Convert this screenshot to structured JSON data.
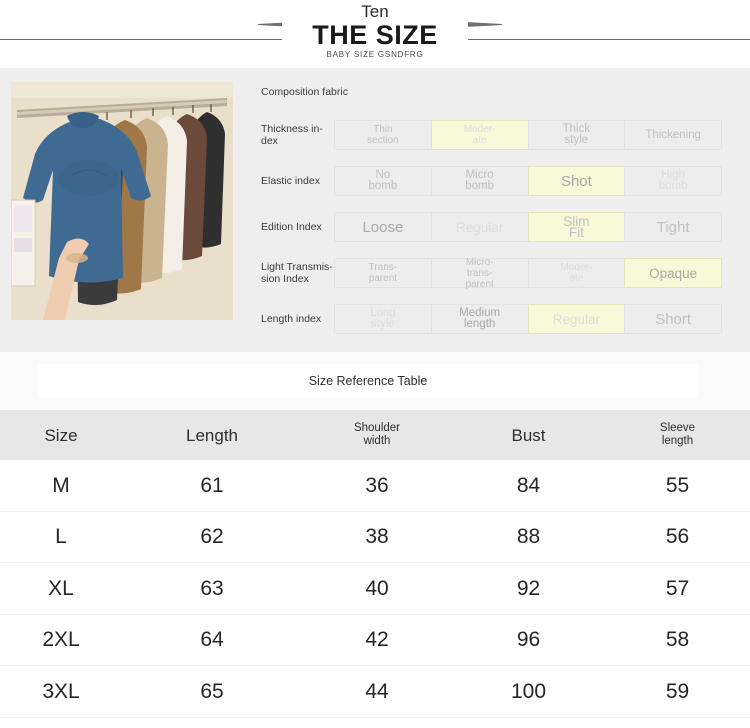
{
  "header": {
    "ghost_glyph": "··",
    "brand": "Ten",
    "title": "THE SIZE",
    "subtitle": "BABY SIZE GSNDFRG"
  },
  "product_photo": {
    "alt_name": "sweaters-on-rack-photo",
    "colors": [
      "#3f6a92",
      "#3b3b3b",
      "#a07848",
      "#c9b48f",
      "#f3efe6",
      "#6b4a3c",
      "#2f2f2f"
    ],
    "background": "#e9dfcb"
  },
  "attributes": {
    "section_label": "Composition fabric",
    "rows": [
      {
        "label": "Thickness in-dex",
        "options": [
          {
            "text": "Thin section",
            "selected": false,
            "size": "s1",
            "tone": "mid"
          },
          {
            "text": "Moder-ate",
            "selected": true,
            "size": "s1",
            "tone": "dim"
          },
          {
            "text": "Thick style",
            "selected": false,
            "size": "s2",
            "tone": "mid"
          },
          {
            "text": "Thickening",
            "selected": false,
            "size": "s2",
            "tone": "mid"
          }
        ]
      },
      {
        "label": "Elastic index",
        "options": [
          {
            "text": "No bomb",
            "selected": false,
            "size": "s2",
            "tone": "mid"
          },
          {
            "text": "Micro bomb",
            "selected": false,
            "size": "s2",
            "tone": "mid"
          },
          {
            "text": "Shot",
            "selected": true,
            "size": "s4",
            "tone": "dark"
          },
          {
            "text": "High bomb",
            "selected": false,
            "size": "s2",
            "tone": "dim"
          }
        ]
      },
      {
        "label": "Edition Index",
        "options": [
          {
            "text": "Loose",
            "selected": false,
            "size": "s4",
            "tone": "dark"
          },
          {
            "text": "Regular",
            "selected": false,
            "size": "s3",
            "tone": "dim"
          },
          {
            "text": "Slim Fit",
            "selected": true,
            "size": "s3",
            "tone": "mid"
          },
          {
            "text": "Tight",
            "selected": false,
            "size": "s4",
            "tone": "mid"
          }
        ]
      },
      {
        "label": "Light Transmis-sion Index",
        "options": [
          {
            "text": "Trans-parent",
            "selected": false,
            "size": "s1",
            "tone": "mid"
          },
          {
            "text": "Micro-trans-parent",
            "selected": false,
            "size": "s1",
            "tone": "mid"
          },
          {
            "text": "Moder-ate",
            "selected": false,
            "size": "s1",
            "tone": "dim"
          },
          {
            "text": "Opaque",
            "selected": true,
            "size": "s3",
            "tone": "dark"
          }
        ]
      },
      {
        "label": "Length index",
        "options": [
          {
            "text": "Long style",
            "selected": false,
            "size": "s2",
            "tone": "dim"
          },
          {
            "text": "Medium length",
            "selected": false,
            "size": "s2",
            "tone": "dark"
          },
          {
            "text": "Regular",
            "selected": true,
            "size": "s3",
            "tone": "dim"
          },
          {
            "text": "Short",
            "selected": false,
            "size": "s4",
            "tone": "mid"
          }
        ]
      }
    ]
  },
  "size_reference": {
    "banner": "Size Reference Table",
    "columns": [
      "Size",
      "Length",
      "Shoulder width",
      "Bust",
      "Sleeve length"
    ],
    "rows": [
      {
        "size": "M",
        "length": "61",
        "shoulder": "36",
        "bust": "84",
        "sleeve": "55"
      },
      {
        "size": "L",
        "length": "62",
        "shoulder": "38",
        "bust": "88",
        "sleeve": "56"
      },
      {
        "size": "XL",
        "length": "63",
        "shoulder": "40",
        "bust": "92",
        "sleeve": "57"
      },
      {
        "size": "2XL",
        "length": "64",
        "shoulder": "42",
        "bust": "96",
        "sleeve": "58"
      },
      {
        "size": "3XL",
        "length": "65",
        "shoulder": "44",
        "bust": "100",
        "sleeve": "59"
      }
    ]
  },
  "colors": {
    "panel_bg": "#eeeeee",
    "highlight": "#f9f8d8",
    "highlight_border": "#e6e4bb",
    "header_row_bg": "#e7e7e7",
    "rule": "#6e6e6e"
  }
}
